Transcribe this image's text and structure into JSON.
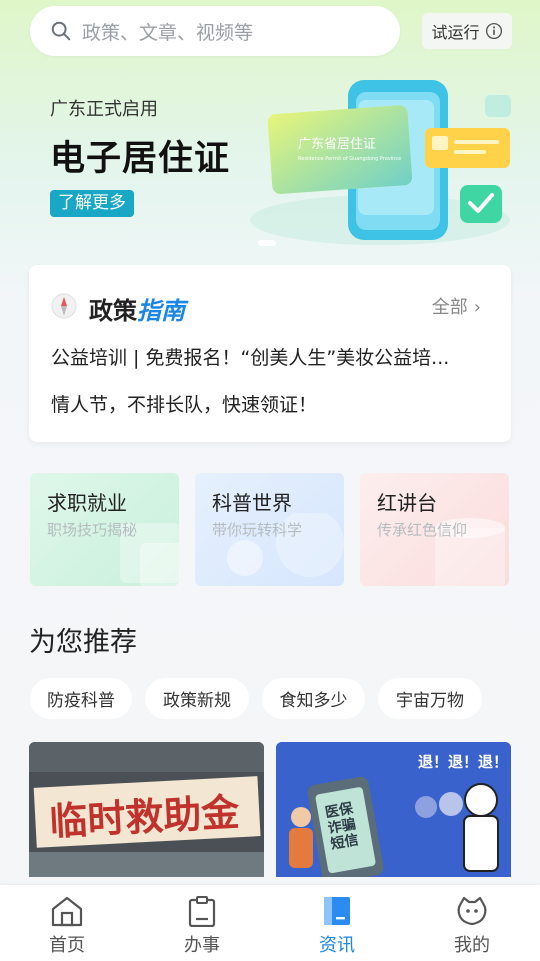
{
  "search": {
    "placeholder": "政策、文章、视频等"
  },
  "trial_label": "试运行",
  "banner": {
    "subtitle": "广东正式启用",
    "title": "电子居住证",
    "button": "了解更多",
    "card_text": "广东省居住证",
    "card_subtext": "Residence Permit of Guangdong Province"
  },
  "policy": {
    "title_prefix": "政策",
    "title_accent": "指南",
    "more_label": "全部",
    "items": [
      "公益培训 | 免费报名！“创美人生”美妆公益培...",
      "情人节，不排长队，快速领证！"
    ]
  },
  "categories": [
    {
      "title": "求职就业",
      "subtitle": "职场技巧揭秘"
    },
    {
      "title": "科普世界",
      "subtitle": "带你玩转科学"
    },
    {
      "title": "红讲台",
      "subtitle": "传承红色信仰"
    }
  ],
  "recommend": {
    "title": "为您推荐",
    "chips": [
      "防疫科普",
      "政策新规",
      "食知多少",
      "宇宙万物"
    ]
  },
  "articles": [
    {
      "thumb_text": "临时救助金"
    },
    {
      "thumb_text": "医保诈骗短信",
      "thumb_top": "退！退！退！"
    }
  ],
  "nav": {
    "items": [
      {
        "label": "首页",
        "icon": "home-icon"
      },
      {
        "label": "办事",
        "icon": "clipboard-icon"
      },
      {
        "label": "资讯",
        "icon": "news-icon",
        "active": true
      },
      {
        "label": "我的",
        "icon": "profile-icon"
      }
    ]
  },
  "colors": {
    "accent": "#1a86e8",
    "teal": "#19a7c6"
  }
}
